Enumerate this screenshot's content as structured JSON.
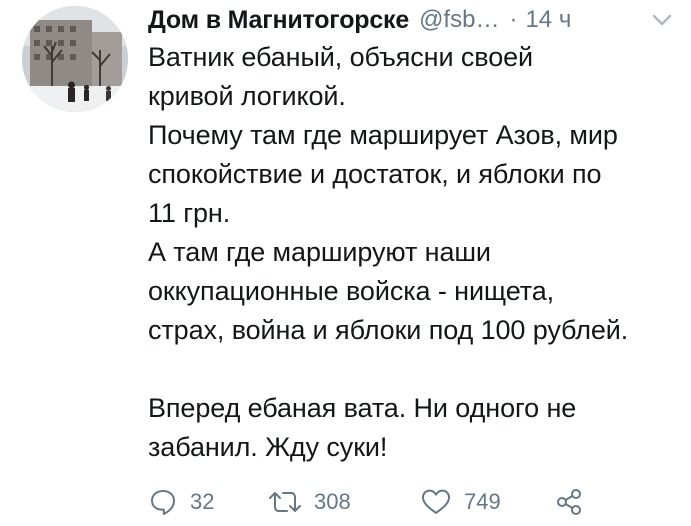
{
  "tweet": {
    "display_name": "Дом в Магнитогорске",
    "handle": "@fsb…",
    "separator": "·",
    "time": "14 ч",
    "text": "Ватник ебаный, объясни своей\nкривой логикой.\nПочему там где марширует Азов, мир\nспокойствие и достаток, и яблоки по\n11 грн.\nА там где маршируют наши\nоккупационные войска - нищета,\nстрах, война и яблоки под 100 рублей.\n\nВперед ебаная вата. Ни одного не\nзабанил. Жду суки!",
    "icons": {
      "avatar": "profile-photo",
      "menu": "chevron-down-icon",
      "reply": "reply-icon",
      "retweet": "retweet-icon",
      "like": "heart-icon",
      "share": "share-icon"
    },
    "actions": {
      "replies": "32",
      "retweets": "308",
      "likes": "749"
    }
  },
  "colors": {
    "text": "#14171a",
    "secondary": "#657786",
    "background": "#ffffff"
  }
}
